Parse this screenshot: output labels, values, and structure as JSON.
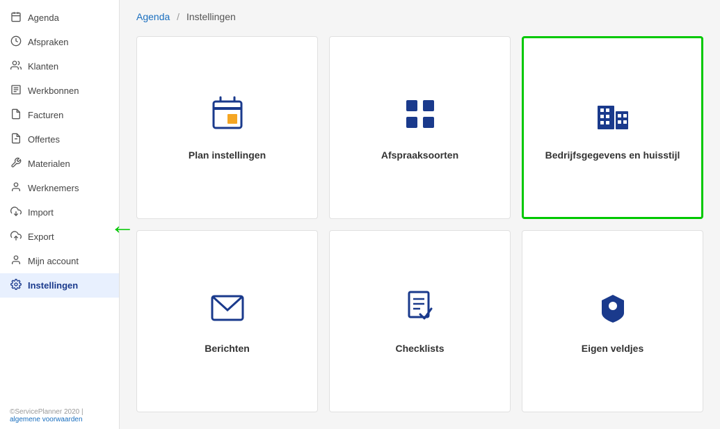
{
  "sidebar": {
    "items": [
      {
        "id": "agenda",
        "label": "Agenda",
        "icon": "📅"
      },
      {
        "id": "afspraken",
        "label": "Afspraken",
        "icon": "🕐"
      },
      {
        "id": "klanten",
        "label": "Klanten",
        "icon": "👥"
      },
      {
        "id": "werkbonnen",
        "label": "Werkbonnen",
        "icon": "📋"
      },
      {
        "id": "facturen",
        "label": "Facturen",
        "icon": "📄"
      },
      {
        "id": "offertes",
        "label": "Offertes",
        "icon": "📄"
      },
      {
        "id": "materialen",
        "label": "Materialen",
        "icon": "🔧"
      },
      {
        "id": "werknemers",
        "label": "Werknemers",
        "icon": "👤"
      },
      {
        "id": "import",
        "label": "Import",
        "icon": "⬇"
      },
      {
        "id": "export",
        "label": "Export",
        "icon": "⬆"
      },
      {
        "id": "mijn-account",
        "label": "Mijn account",
        "icon": "👤"
      },
      {
        "id": "instellingen",
        "label": "Instellingen",
        "icon": "⚙"
      }
    ],
    "footer_text": "©ServicePlanner 2020 |",
    "footer_link": "algemene voorwaarden"
  },
  "breadcrumb": {
    "parent": "Agenda",
    "separator": "/",
    "current": "Instellingen"
  },
  "cards": [
    {
      "id": "plan-instellingen",
      "label": "Plan instellingen",
      "active": false
    },
    {
      "id": "afspraaksoorten",
      "label": "Afspraaksoorten",
      "active": false
    },
    {
      "id": "bedrijfsgegevens",
      "label": "Bedrijfsgegevens en huisstijl",
      "active": true
    },
    {
      "id": "berichten",
      "label": "Berichten",
      "active": false
    },
    {
      "id": "checklists",
      "label": "Checklists",
      "active": false
    },
    {
      "id": "eigen-veldjes",
      "label": "Eigen veldjes",
      "active": false
    }
  ]
}
